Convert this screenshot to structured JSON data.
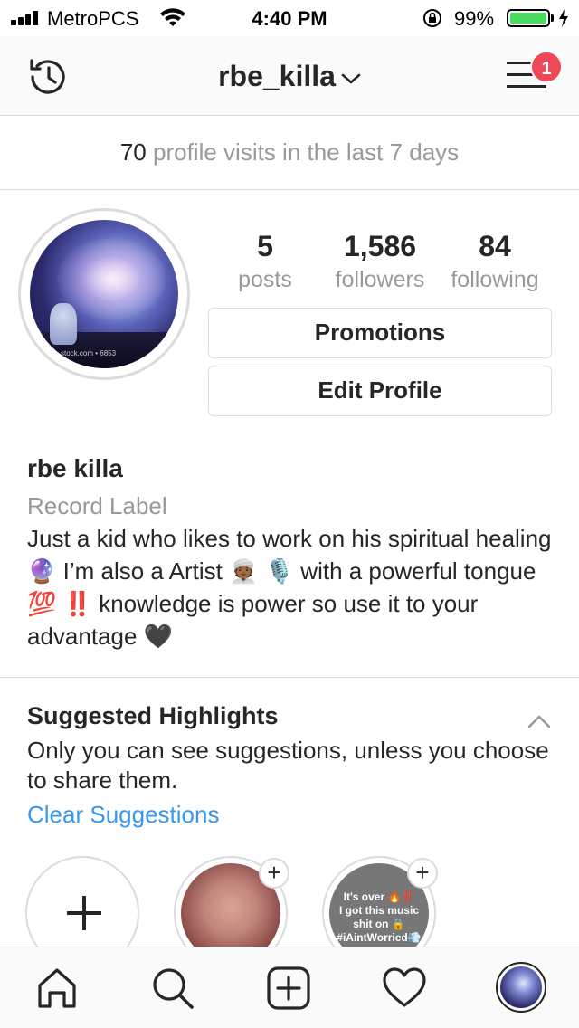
{
  "status_bar": {
    "carrier": "MetroPCS",
    "time": "4:40 PM",
    "battery_percent": "99%",
    "battery_level": 0.99
  },
  "nav": {
    "username": "rbe_killa",
    "menu_badge": "1",
    "icons": [
      "history-icon",
      "chevron-down-icon",
      "menu-icon"
    ]
  },
  "visits": {
    "count": "70",
    "label": "profile visits in the last 7 days"
  },
  "profile": {
    "stats": [
      {
        "value": "5",
        "label": "posts"
      },
      {
        "value": "1,586",
        "label": "followers"
      },
      {
        "value": "84",
        "label": "following"
      }
    ],
    "promotions_label": "Promotions",
    "edit_profile_label": "Edit Profile",
    "name": "rbe killa",
    "category": "Record Label",
    "bio": "Just a kid who likes to work on his spiritual healing 🔮 I’m also a Artist 👳🏾 🎙️ with a powerful tongue 💯 ‼️ knowledge is power so use it to your advantage 🖤"
  },
  "highlights": {
    "title": "Suggested Highlights",
    "description": "Only you can see suggestions, unless you choose to share them.",
    "clear_label": "Clear Suggestions",
    "story3_lines": [
      "It's over 🔥‼️",
      "I got this music",
      "shit on 🔒",
      "#iAintWorried💨"
    ]
  },
  "tabbar": {
    "icons": [
      "home-icon",
      "search-icon",
      "add-post-icon",
      "heart-icon",
      "profile-avatar"
    ]
  }
}
